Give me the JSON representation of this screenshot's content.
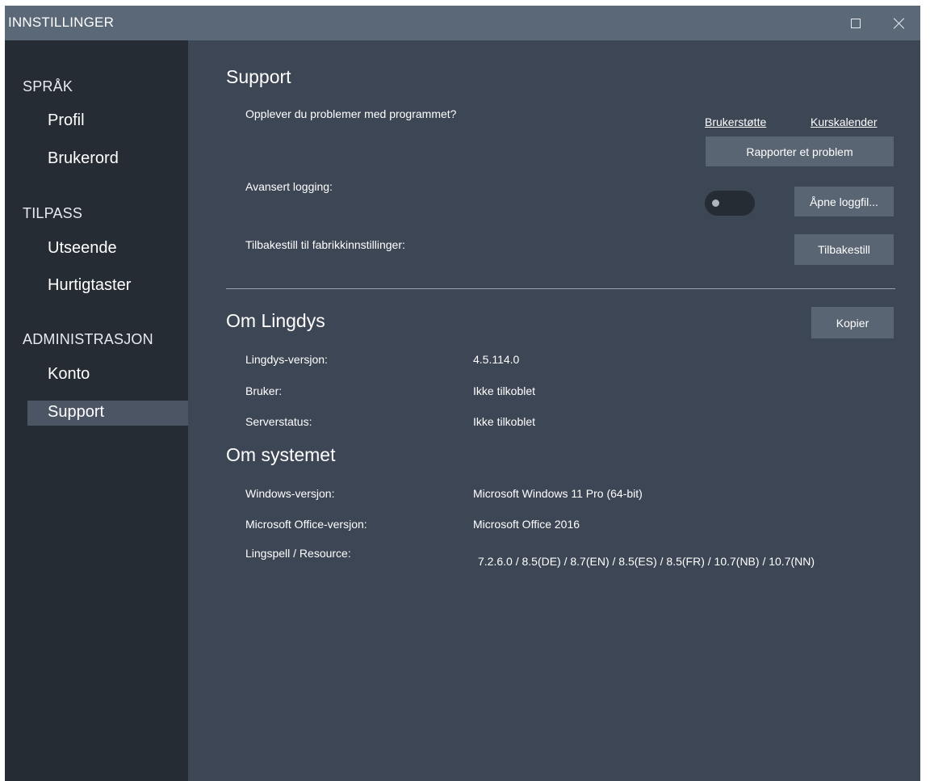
{
  "window": {
    "title": "INNSTILLINGER"
  },
  "sidebar": {
    "sections": [
      {
        "label": "SPRÅK",
        "items": [
          {
            "label": "Profil"
          },
          {
            "label": "Brukerord"
          }
        ]
      },
      {
        "label": "TILPASS",
        "items": [
          {
            "label": "Utseende"
          },
          {
            "label": "Hurtigtaster"
          }
        ]
      },
      {
        "label": "ADMINISTRASJON",
        "items": [
          {
            "label": "Konto"
          },
          {
            "label": "Support",
            "active": true
          }
        ]
      }
    ]
  },
  "support": {
    "heading": "Support",
    "problem_question": "Opplever du problemer med programmet?",
    "link_support": "Brukerstøtte",
    "link_calendar": "Kurskalender",
    "report_button": "Rapporter et problem",
    "logging_label": "Avansert logging:",
    "logging_enabled": false,
    "open_log_button": "Åpne loggfil...",
    "reset_label": "Tilbakestill til fabrikkinnstillinger:",
    "reset_button": "Tilbakestill"
  },
  "about_lingdys": {
    "heading": "Om Lingdys",
    "copy_button": "Kopier",
    "rows": [
      {
        "label": "Lingdys-versjon:",
        "value": "4.5.114.0"
      },
      {
        "label": "Bruker:",
        "value": "Ikke tilkoblet"
      },
      {
        "label": "Serverstatus:",
        "value": "Ikke tilkoblet"
      }
    ]
  },
  "about_system": {
    "heading": "Om systemet",
    "rows": [
      {
        "label": "Windows-versjon:",
        "value": "Microsoft Windows 11 Pro (64-bit)"
      },
      {
        "label": "Microsoft Office-versjon:",
        "value": "Microsoft Office 2016"
      },
      {
        "label": "Lingspell / Resource:",
        "value": "7.2.6.0 / 8.5(DE) / 8.7(EN) / 8.5(ES) / 8.5(FR) / 10.7(NB) / 10.7(NN)"
      }
    ]
  },
  "colors": {
    "titlebar": "#5b6877",
    "sidebar": "#262c34",
    "content": "#3d4654",
    "button": "#5a6573",
    "active_item": "#4b5564"
  }
}
